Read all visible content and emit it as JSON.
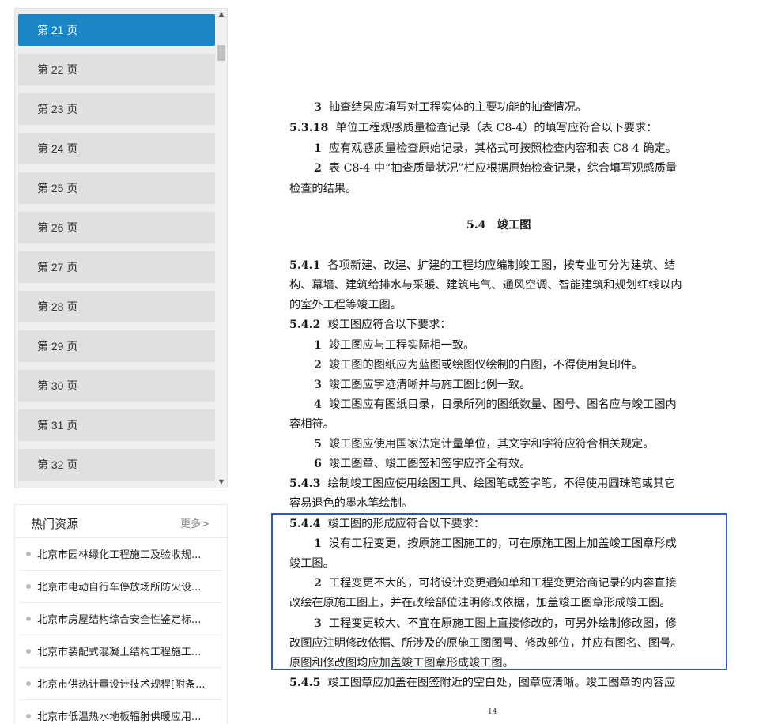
{
  "page_list": {
    "items": [
      "第 21 页",
      "第 22 页",
      "第 23 页",
      "第 24 页",
      "第 25 页",
      "第 26 页",
      "第 27 页",
      "第 28 页",
      "第 29 页",
      "第 30 页",
      "第 31 页",
      "第 32 页"
    ],
    "active_index": 0,
    "scrollbar": {
      "up_arrow": "▲",
      "down_arrow": "▼"
    }
  },
  "hot_resources": {
    "title": "热门资源",
    "more": "更多>",
    "items": [
      "北京市园林绿化工程施工及验收规...",
      "北京市电动自行车停放场所防火设...",
      "北京市房屋结构综合安全性鉴定标...",
      "北京市装配式混凝土结构工程施工...",
      "北京市供热计量设计技术规程[附条...",
      "北京市低温热水地板辐射供暖应用..."
    ]
  },
  "document": {
    "lines": [
      {
        "num": "3",
        "text": "抽查结果应填写对工程实体的主要功能的抽查情况。"
      },
      {
        "num": "5.3.18",
        "text": "单位工程观感质量检查记录（表 C8-4）的填写应符合以下要求："
      },
      {
        "num": "1",
        "text": "应有观感质量检查原始记录，其格式可按照检查内容和表 C8-4 确定。"
      },
      {
        "num": "2",
        "text": "表 C8-4 中“抽查质量状况”栏应根据原始检查记录，综合填写观感质量"
      },
      {
        "num": "",
        "text": "检查的结果。"
      },
      {
        "num": "",
        "text": "5.4　竣工图"
      },
      {
        "num": "5.4.1",
        "text": "各项新建、改建、扩建的工程均应编制竣工图，按专业可分为建筑、结"
      },
      {
        "num": "",
        "text": "构、幕墙、建筑给排水与采暖、建筑电气、通风空调、智能建筑和规划红线以内"
      },
      {
        "num": "",
        "text": "的室外工程等竣工图。"
      },
      {
        "num": "5.4.2",
        "text": "竣工图应符合以下要求："
      },
      {
        "num": "1",
        "text": "竣工图应与工程实际相一致。"
      },
      {
        "num": "2",
        "text": "竣工图的图纸应为蓝图或绘图仪绘制的白图，不得使用复印件。"
      },
      {
        "num": "3",
        "text": "竣工图应字迹清晰并与施工图比例一致。"
      },
      {
        "num": "4",
        "text": "竣工图应有图纸目录，目录所列的图纸数量、图号、图名应与竣工图内"
      },
      {
        "num": "",
        "text": "容相符。"
      },
      {
        "num": "5",
        "text": "竣工图应使用国家法定计量单位，其文字和字符应符合相关规定。"
      },
      {
        "num": "6",
        "text": "竣工图章、竣工图签和签字应齐全有效。"
      },
      {
        "num": "5.4.3",
        "text": "绘制竣工图应使用绘图工具、绘图笔或签字笔，不得使用圆珠笔或其它"
      },
      {
        "num": "",
        "text": "容易退色的墨水笔绘制。"
      },
      {
        "num": "5.4.4",
        "text": "竣工图的形成应符合以下要求："
      },
      {
        "num": "1",
        "text": "没有工程变更，按原施工图施工的，可在原施工图上加盖竣工图章形成"
      },
      {
        "num": "",
        "text": "竣工图。"
      },
      {
        "num": "2",
        "text": "工程变更不大的，可将设计变更通知单和工程变更洽商记录的内容直接"
      },
      {
        "num": "",
        "text": "改绘在原施工图上，并在改绘部位注明修改依据，加盖竣工图章形成竣工图。"
      },
      {
        "num": "3",
        "text": "工程变更较大、不宜在原施工图上直接修改的，可另外绘制修改图，修"
      },
      {
        "num": "",
        "text": "改图应注明修改依据、所涉及的原施工图图号、修改部位，并应有图名、图号。"
      },
      {
        "num": "",
        "text": "原图和修改图均应加盖竣工图章形成竣工图。"
      },
      {
        "num": "5.4.5",
        "text": "竣工图章应加盖在图签附近的空白处，图章应清晰。竣工图章的内容应"
      }
    ],
    "page_number": "14"
  },
  "colors": {
    "active_item": "#1a86c6",
    "highlight_box": "#2e59c6"
  }
}
